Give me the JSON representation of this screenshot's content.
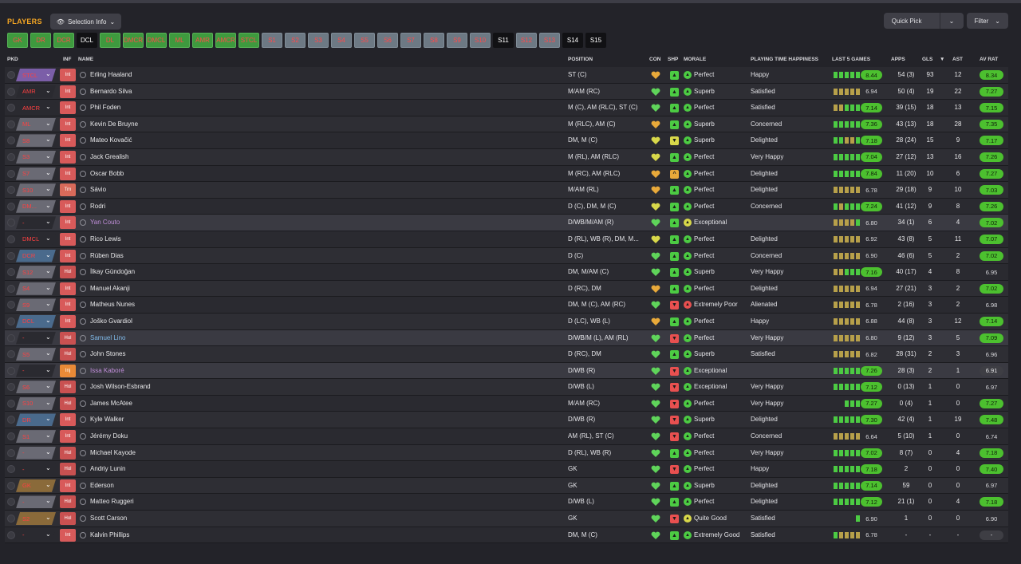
{
  "header": {
    "title": "PLAYERS",
    "selection_info": "Selection Info",
    "quick_pick": "Quick Pick",
    "filter": "Filter"
  },
  "positions": [
    {
      "label": "GK",
      "style": "g"
    },
    {
      "label": "DR",
      "style": "g"
    },
    {
      "label": "DCR",
      "style": "g"
    },
    {
      "label": "DCL",
      "style": "dk"
    },
    {
      "label": "DL",
      "style": "g"
    },
    {
      "label": "DMCR",
      "style": "g"
    },
    {
      "label": "DMCL",
      "style": "g"
    },
    {
      "label": "ML",
      "style": "g"
    },
    {
      "label": "AMR",
      "style": "g"
    },
    {
      "label": "AMCR",
      "style": "g"
    },
    {
      "label": "STCL",
      "style": "g"
    },
    {
      "label": "S1",
      "style": "gr"
    },
    {
      "label": "S2",
      "style": "gr"
    },
    {
      "label": "S3",
      "style": "gr"
    },
    {
      "label": "S4",
      "style": "gr"
    },
    {
      "label": "S5",
      "style": "gr"
    },
    {
      "label": "S6",
      "style": "gr"
    },
    {
      "label": "S7",
      "style": "gr"
    },
    {
      "label": "S8",
      "style": "gr"
    },
    {
      "label": "S9",
      "style": "gr"
    },
    {
      "label": "S10",
      "style": "gr"
    },
    {
      "label": "S11",
      "style": "dk"
    },
    {
      "label": "S12",
      "style": "gr"
    },
    {
      "label": "S13",
      "style": "gr"
    },
    {
      "label": "S14",
      "style": "dk"
    },
    {
      "label": "S15",
      "style": "dk"
    }
  ],
  "columns": {
    "pkd": "PKD",
    "inf": "INF",
    "name": "NAME",
    "position": "POSITION",
    "con": "CON",
    "shp": "SHP",
    "morale": "MORALE",
    "pth": "PLAYING TIME HAPPINESS",
    "last5": "LAST 5 GAMES",
    "apps": "APPS",
    "gls": "GLS",
    "ast": "AST",
    "avrat": "AV RAT"
  },
  "colors": {
    "accent": "#f5a623",
    "green": "#3e9a3e",
    "rating_green": "#4cc02f",
    "rating_grey": "#3e3e44",
    "injury": "#e98a37",
    "status_red": "#d85a5a"
  },
  "rows": [
    {
      "pkd": "STCL",
      "pkc": "#7b5ea8",
      "inf": "Int",
      "name": "Erling Haaland",
      "pos": "ST (C)",
      "con": "#e8a93a",
      "shp": "#4ccb43",
      "shps": "▲",
      "md": "#4ccb43",
      "morale": "Perfect",
      "pth": "Happy",
      "form": [
        "#4ccb43",
        "#4ccb43",
        "#4ccb43",
        "#4ccb43",
        "#4ccb43"
      ],
      "rating": "8.44",
      "rs": "g",
      "apps": "54 (3)",
      "gls": "93",
      "ast": "12",
      "avr": "8.34",
      "avs": "g"
    },
    {
      "pkd": "AMR",
      "pkc": "#2a2a30",
      "inf": "Int",
      "name": "Bernardo Silva",
      "pos": "M/AM (RC)",
      "con": "#5fd45a",
      "shp": "#4ccb43",
      "shps": "▲",
      "md": "#4ccb43",
      "morale": "Superb",
      "pth": "Satisfied",
      "form": [
        "#b7a04a",
        "#b7a04a",
        "#b7a04a",
        "#b7a04a",
        "#b7a04a"
      ],
      "rating": "6.94",
      "rs": "n",
      "apps": "50 (4)",
      "gls": "19",
      "ast": "22",
      "avr": "7.27",
      "avs": "g"
    },
    {
      "pkd": "AMCR",
      "pkc": "#2a2a30",
      "inf": "Int",
      "name": "Phil Foden",
      "pos": "M (C), AM (RLC), ST (C)",
      "con": "#5fd45a",
      "shp": "#4ccb43",
      "shps": "▲",
      "md": "#4ccb43",
      "morale": "Perfect",
      "pth": "Satisfied",
      "form": [
        "#b7a04a",
        "#b7a04a",
        "#4ccb43",
        "#4ccb43",
        "#4ccb43"
      ],
      "rating": "7.14",
      "rs": "g",
      "apps": "39 (15)",
      "gls": "18",
      "ast": "13",
      "avr": "7.15",
      "avs": "g"
    },
    {
      "pkd": "ML",
      "pkc": "#6a6a74",
      "inf": "Int",
      "name": "Kevin De Bruyne",
      "pos": "M (RLC), AM (C)",
      "con": "#e8a93a",
      "shp": "#4ccb43",
      "shps": "▲",
      "md": "#4ccb43",
      "morale": "Superb",
      "pth": "Concerned",
      "form": [
        "#4ccb43",
        "#4ccb43",
        "#4ccb43",
        "#4ccb43",
        "#4ccb43"
      ],
      "rating": "7.36",
      "rs": "g",
      "apps": "43 (13)",
      "gls": "18",
      "ast": "28",
      "avr": "7.35",
      "avs": "g"
    },
    {
      "pkd": "S8",
      "pkc": "#6a6a74",
      "inf": "Int",
      "name": "Mateo Kovačić",
      "pos": "DM, M (C)",
      "con": "#d8d84a",
      "shp": "#d8d84a",
      "shps": "▼",
      "md": "#4ccb43",
      "morale": "Superb",
      "pth": "Delighted",
      "form": [
        "#4ccb43",
        "#4ccb43",
        "#b7a04a",
        "#b7a04a",
        "#4ccb43"
      ],
      "rating": "7.18",
      "rs": "g",
      "apps": "28 (24)",
      "gls": "15",
      "ast": "9",
      "avr": "7.17",
      "avs": "g"
    },
    {
      "pkd": "S3",
      "pkc": "#6a6a74",
      "inf": "Int",
      "name": "Jack Grealish",
      "pos": "M (RL), AM (RLC)",
      "con": "#d8d84a",
      "shp": "#4ccb43",
      "shps": "▲",
      "md": "#4ccb43",
      "morale": "Perfect",
      "pth": "Very Happy",
      "form": [
        "#4ccb43",
        "#4ccb43",
        "#4ccb43",
        "#4ccb43",
        "#4ccb43"
      ],
      "rating": "7.04",
      "rs": "g",
      "apps": "27 (12)",
      "gls": "13",
      "ast": "16",
      "avr": "7.26",
      "avs": "g"
    },
    {
      "pkd": "S7",
      "pkc": "#6a6a74",
      "inf": "Int",
      "name": "Oscar Bobb",
      "pos": "M (RC), AM (RLC)",
      "con": "#e8a93a",
      "shp": "#e8a93a",
      "shps": "^",
      "md": "#4ccb43",
      "morale": "Perfect",
      "pth": "Delighted",
      "form": [
        "#4ccb43",
        "#4ccb43",
        "#4ccb43",
        "#4ccb43",
        "#4ccb43"
      ],
      "rating": "7.84",
      "rs": "g",
      "apps": "11 (20)",
      "gls": "10",
      "ast": "6",
      "avr": "7.27",
      "avs": "g"
    },
    {
      "pkd": "S10",
      "pkc": "#6a6a74",
      "inf": "Trn",
      "name": "Sávio",
      "pos": "M/AM (RL)",
      "con": "#e8a93a",
      "shp": "#4ccb43",
      "shps": "▲",
      "md": "#4ccb43",
      "morale": "Perfect",
      "pth": "Delighted",
      "form": [
        "#b7a04a",
        "#b7a04a",
        "#b7a04a",
        "#b7a04a",
        "#b7a04a"
      ],
      "rating": "6.78",
      "rs": "n",
      "apps": "29 (18)",
      "gls": "9",
      "ast": "10",
      "avr": "7.03",
      "avs": "g"
    },
    {
      "pkd": "DM...",
      "pkc": "#6a6a74",
      "inf": "Int",
      "name": "Rodri",
      "pos": "D (C), DM, M (C)",
      "con": "#d8d84a",
      "shp": "#4ccb43",
      "shps": "▲",
      "md": "#4ccb43",
      "morale": "Perfect",
      "pth": "Concerned",
      "form": [
        "#4ccb43",
        "#b7a04a",
        "#4ccb43",
        "#4ccb43",
        "#4ccb43"
      ],
      "rating": "7.24",
      "rs": "g",
      "apps": "41 (12)",
      "gls": "9",
      "ast": "8",
      "avr": "7.26",
      "avs": "g"
    },
    {
      "pkd": "-",
      "pkc": "#2a2a30",
      "inf": "Int",
      "name": "Yan Couto",
      "nm": "loan",
      "hl": true,
      "pos": "D/WB/M/AM (R)",
      "con": "#5fd45a",
      "shp": "#4ccb43",
      "shps": "▲",
      "md": "#d8d84a",
      "morale": "Exceptional",
      "pth": "",
      "form": [
        "#b7a04a",
        "#b7a04a",
        "#b7a04a",
        "#b7a04a",
        "#4ccb43"
      ],
      "rating": "6.80",
      "rs": "n",
      "apps": "34 (1)",
      "gls": "6",
      "ast": "4",
      "avr": "7.02",
      "avs": "g"
    },
    {
      "pkd": "DMCL",
      "pkc": "#2a2a30",
      "inf": "Int",
      "name": "Rico Lewis",
      "pos": "D (RL), WB (R), DM, M...",
      "con": "#d8d84a",
      "shp": "#4ccb43",
      "shps": "▲",
      "md": "#4ccb43",
      "morale": "Perfect",
      "pth": "Delighted",
      "form": [
        "#b7a04a",
        "#b7a04a",
        "#b7a04a",
        "#b7a04a",
        "#b7a04a"
      ],
      "rating": "6.92",
      "rs": "n",
      "apps": "43 (8)",
      "gls": "5",
      "ast": "11",
      "avr": "7.07",
      "avs": "g"
    },
    {
      "pkd": "DCR",
      "pkc": "#4a6a8c",
      "inf": "Int",
      "name": "Rúben Dias",
      "pos": "D (C)",
      "con": "#5fd45a",
      "shp": "#4ccb43",
      "shps": "▲",
      "md": "#4ccb43",
      "morale": "Perfect",
      "pth": "Concerned",
      "form": [
        "#b7a04a",
        "#b7a04a",
        "#b7a04a",
        "#b7a04a",
        "#b7a04a"
      ],
      "rating": "6.90",
      "rs": "n",
      "apps": "46 (6)",
      "gls": "5",
      "ast": "2",
      "avr": "7.02",
      "avs": "g"
    },
    {
      "pkd": "S12",
      "pkc": "#6a6a74",
      "inf": "Hol",
      "name": "İlkay Gündoğan",
      "pos": "DM, M/AM (C)",
      "con": "#5fd45a",
      "shp": "#4ccb43",
      "shps": "▲",
      "md": "#4ccb43",
      "morale": "Superb",
      "pth": "Very Happy",
      "form": [
        "#b7a04a",
        "#b7a04a",
        "#4ccb43",
        "#4ccb43",
        "#4ccb43"
      ],
      "rating": "7.16",
      "rs": "g",
      "apps": "40 (17)",
      "gls": "4",
      "ast": "8",
      "avr": "6.95",
      "avs": "n"
    },
    {
      "pkd": "S4",
      "pkc": "#6a6a74",
      "inf": "Int",
      "name": "Manuel Akanji",
      "pos": "D (RC), DM",
      "con": "#e8a93a",
      "shp": "#4ccb43",
      "shps": "▲",
      "md": "#4ccb43",
      "morale": "Perfect",
      "pth": "Delighted",
      "form": [
        "#b7a04a",
        "#b7a04a",
        "#b7a04a",
        "#b7a04a",
        "#b7a04a"
      ],
      "rating": "6.94",
      "rs": "n",
      "apps": "27 (21)",
      "gls": "3",
      "ast": "2",
      "avr": "7.02",
      "avs": "g"
    },
    {
      "pkd": "S9",
      "pkc": "#6a6a74",
      "inf": "Int",
      "name": "Matheus Nunes",
      "pos": "DM, M (C), AM (RC)",
      "con": "#5fd45a",
      "shp": "#e85050",
      "shps": "▼",
      "md": "#e85050",
      "morale": "Extremely Poor",
      "pth": "Alienated",
      "form": [
        "#b7a04a",
        "#b7a04a",
        "#b7a04a",
        "#b7a04a",
        "#b7a04a"
      ],
      "rating": "6.78",
      "rs": "n",
      "apps": "2 (16)",
      "gls": "3",
      "ast": "2",
      "avr": "6.98",
      "avs": "n"
    },
    {
      "pkd": "DCL",
      "pkc": "#4a6a8c",
      "inf": "Int",
      "name": "Joško Gvardiol",
      "pos": "D (LC), WB (L)",
      "con": "#e8a93a",
      "shp": "#4ccb43",
      "shps": "▲",
      "md": "#4ccb43",
      "morale": "Perfect",
      "pth": "Happy",
      "form": [
        "#b7a04a",
        "#b7a04a",
        "#b7a04a",
        "#b7a04a",
        "#b7a04a"
      ],
      "rating": "6.88",
      "rs": "n",
      "apps": "44 (8)",
      "gls": "3",
      "ast": "12",
      "avr": "7.14",
      "avs": "g"
    },
    {
      "pkd": "-",
      "pkc": "#2a2a30",
      "inf": "Hol",
      "name": "Samuel Lino",
      "nm": "blue",
      "hl": true,
      "pos": "D/WB/M (L), AM (RL)",
      "con": "#5fd45a",
      "shp": "#e85050",
      "shps": "▼",
      "md": "#4ccb43",
      "morale": "Perfect",
      "pth": "Very Happy",
      "form": [
        "#b7a04a",
        "#b7a04a",
        "#b7a04a",
        "#b7a04a",
        "#b7a04a"
      ],
      "rating": "6.80",
      "rs": "n",
      "apps": "9 (12)",
      "gls": "3",
      "ast": "5",
      "avr": "7.09",
      "avs": "g"
    },
    {
      "pkd": "S5",
      "pkc": "#6a6a74",
      "inf": "Hol",
      "name": "John Stones",
      "pos": "D (RC), DM",
      "con": "#5fd45a",
      "shp": "#4ccb43",
      "shps": "▲",
      "md": "#4ccb43",
      "morale": "Superb",
      "pth": "Satisfied",
      "form": [
        "#b7a04a",
        "#b7a04a",
        "#b7a04a",
        "#b7a04a",
        "#b7a04a"
      ],
      "rating": "6.82",
      "rs": "n",
      "apps": "28 (31)",
      "gls": "2",
      "ast": "3",
      "avr": "6.96",
      "avs": "n"
    },
    {
      "pkd": "-",
      "pkc": "#2a2a30",
      "inf": "Inj",
      "name": "Issa Kaboré",
      "nm": "loan",
      "hl": true,
      "pos": "D/WB (R)",
      "con": "#5fd45a",
      "shp": "#e85050",
      "shps": "▼",
      "md": "#4ccb43",
      "morale": "Exceptional",
      "pth": "",
      "form": [
        "#4ccb43",
        "#4ccb43",
        "#4ccb43",
        "#4ccb43",
        "#4ccb43"
      ],
      "rating": "7.26",
      "rs": "g",
      "apps": "28 (3)",
      "gls": "2",
      "ast": "1",
      "avr": "6.91",
      "avs": "d"
    },
    {
      "pkd": "S6",
      "pkc": "#6a6a74",
      "inf": "Hol",
      "name": "Josh Wilson-Esbrand",
      "pos": "D/WB (L)",
      "con": "#5fd45a",
      "shp": "#e85050",
      "shps": "▼",
      "md": "#4ccb43",
      "morale": "Exceptional",
      "pth": "Very Happy",
      "form": [
        "#4ccb43",
        "#4ccb43",
        "#4ccb43",
        "#4ccb43",
        "#4ccb43"
      ],
      "rating": "7.12",
      "rs": "g",
      "apps": "0 (13)",
      "gls": "1",
      "ast": "0",
      "avr": "6.97",
      "avs": "n"
    },
    {
      "pkd": "S10",
      "pkc": "#6a6a74",
      "inf": "Hol",
      "name": "James McAtee",
      "pos": "M/AM (RC)",
      "con": "#5fd45a",
      "shp": "#e85050",
      "shps": "▼",
      "md": "#4ccb43",
      "morale": "Perfect",
      "pth": "Very Happy",
      "form": [
        "#4ccb43",
        "#4ccb43",
        "#4ccb43"
      ],
      "rating": "7.27",
      "rs": "g",
      "apps": "0 (4)",
      "gls": "1",
      "ast": "0",
      "avr": "7.27",
      "avs": "g"
    },
    {
      "pkd": "DR",
      "pkc": "#4a6a8c",
      "inf": "Int",
      "name": "Kyle Walker",
      "pos": "D/WB (R)",
      "con": "#5fd45a",
      "shp": "#e85050",
      "shps": "▼",
      "md": "#4ccb43",
      "morale": "Superb",
      "pth": "Delighted",
      "form": [
        "#4ccb43",
        "#4ccb43",
        "#4ccb43",
        "#4ccb43",
        "#4ccb43"
      ],
      "rating": "7.30",
      "rs": "g",
      "apps": "42 (4)",
      "gls": "1",
      "ast": "19",
      "avr": "7.48",
      "avs": "g"
    },
    {
      "pkd": "S1",
      "pkc": "#6a6a74",
      "inf": "Int",
      "name": "Jérémy Doku",
      "pos": "AM (RL), ST (C)",
      "con": "#5fd45a",
      "shp": "#e85050",
      "shps": "▼",
      "md": "#4ccb43",
      "morale": "Perfect",
      "pth": "Concerned",
      "form": [
        "#b7a04a",
        "#b7a04a",
        "#b7a04a",
        "#b7a04a",
        "#b7a04a"
      ],
      "rating": "6.64",
      "rs": "n",
      "apps": "5 (10)",
      "gls": "1",
      "ast": "0",
      "avr": "6.74",
      "avs": "n"
    },
    {
      "pkd": "-",
      "pkc": "#6a6a74",
      "inf": "Hol",
      "name": "Michael Kayode",
      "pos": "D (RL), WB (R)",
      "con": "#5fd45a",
      "shp": "#4ccb43",
      "shps": "▲",
      "md": "#4ccb43",
      "morale": "Perfect",
      "pth": "Very Happy",
      "form": [
        "#4ccb43",
        "#4ccb43",
        "#4ccb43",
        "#4ccb43",
        "#4ccb43"
      ],
      "rating": "7.02",
      "rs": "g",
      "apps": "8 (7)",
      "gls": "0",
      "ast": "4",
      "avr": "7.18",
      "avs": "g"
    },
    {
      "pkd": "-",
      "pkc": "#2a2a30",
      "inf": "Hol",
      "name": "Andriy Lunin",
      "pos": "GK",
      "con": "#5fd45a",
      "shp": "#e85050",
      "shps": "▼",
      "md": "#4ccb43",
      "morale": "Perfect",
      "pth": "Happy",
      "form": [
        "#4ccb43",
        "#4ccb43",
        "#4ccb43",
        "#4ccb43",
        "#4ccb43"
      ],
      "rating": "7.18",
      "rs": "g",
      "apps": "2",
      "gls": "0",
      "ast": "0",
      "avr": "7.40",
      "avs": "g"
    },
    {
      "pkd": "GK",
      "pkc": "#8a6a3a",
      "inf": "Int",
      "name": "Ederson",
      "pos": "GK",
      "con": "#5fd45a",
      "shp": "#4ccb43",
      "shps": "▲",
      "md": "#4ccb43",
      "morale": "Superb",
      "pth": "Delighted",
      "form": [
        "#4ccb43",
        "#4ccb43",
        "#4ccb43",
        "#4ccb43",
        "#4ccb43"
      ],
      "rating": "7.14",
      "rs": "g",
      "apps": "59",
      "gls": "0",
      "ast": "0",
      "avr": "6.97",
      "avs": "n"
    },
    {
      "pkd": "-",
      "pkc": "#6a6a74",
      "inf": "Hol",
      "name": "Matteo Ruggeri",
      "pos": "D/WB (L)",
      "con": "#5fd45a",
      "shp": "#4ccb43",
      "shps": "▲",
      "md": "#4ccb43",
      "morale": "Perfect",
      "pth": "Delighted",
      "form": [
        "#4ccb43",
        "#4ccb43",
        "#4ccb43",
        "#4ccb43",
        "#4ccb43"
      ],
      "rating": "7.12",
      "rs": "g",
      "apps": "21 (1)",
      "gls": "0",
      "ast": "4",
      "avr": "7.18",
      "avs": "g"
    },
    {
      "pkd": "S2",
      "pkc": "#8a6a3a",
      "inf": "Hol",
      "name": "Scott Carson",
      "pos": "GK",
      "con": "#5fd45a",
      "shp": "#e85050",
      "shps": "▼",
      "md": "#d8d84a",
      "morale": "Quite Good",
      "pth": "Satisfied",
      "form": [
        "#4ccb43"
      ],
      "rating": "6.90",
      "rs": "n",
      "apps": "1",
      "gls": "0",
      "ast": "0",
      "avr": "6.90",
      "avs": "n"
    },
    {
      "pkd": "-",
      "pkc": "#2a2a30",
      "inf": "Int",
      "name": "Kalvin Phillips",
      "pos": "DM, M (C)",
      "con": "#5fd45a",
      "shp": "#4ccb43",
      "shps": "▲",
      "md": "#4ccb43",
      "morale": "Extremely Good",
      "pth": "Satisfied",
      "form": [
        "#4ccb43",
        "#b7a04a",
        "#b7a04a",
        "#b7a04a",
        "#b7a04a"
      ],
      "rating": "6.78",
      "rs": "n",
      "apps": "-",
      "gls": "-",
      "ast": "-",
      "avr": "-",
      "avs": "d"
    }
  ]
}
